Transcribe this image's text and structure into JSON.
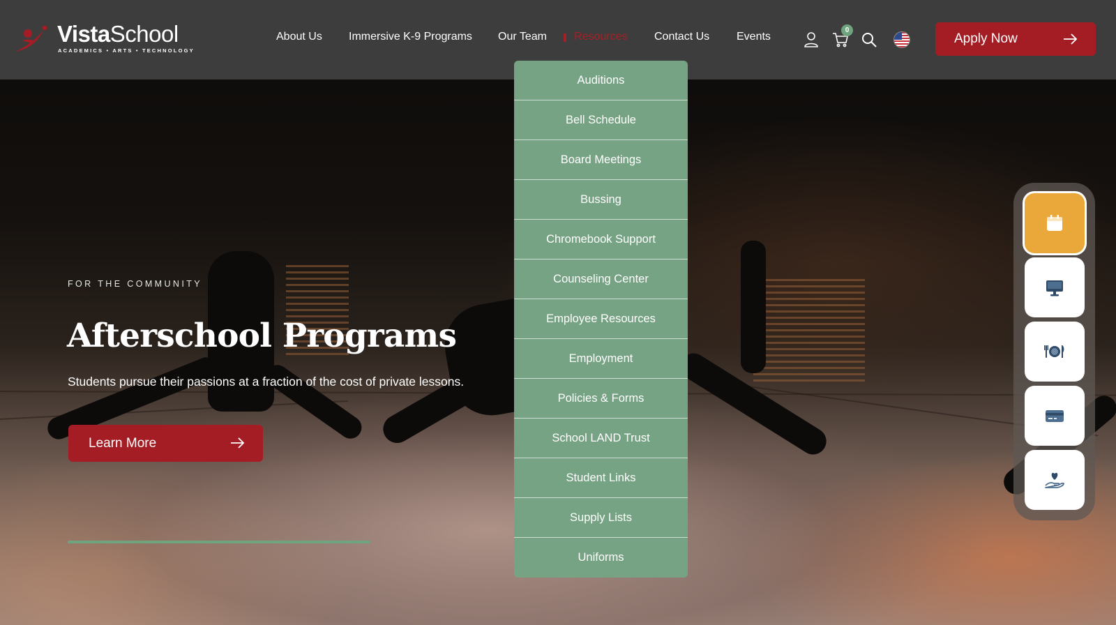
{
  "brand": {
    "name_bold": "Vista",
    "name_light": "School",
    "tagline": "ACADEMICS • ARTS • TECHNOLOGY",
    "accent_red": "#a51d24",
    "accent_green": "#76a383",
    "accent_orange": "#eaa73a"
  },
  "nav": {
    "items": [
      {
        "label": "About Us"
      },
      {
        "label": "Immersive K-9 Programs"
      },
      {
        "label": "Our Team"
      },
      {
        "label": "Resources",
        "active": true
      },
      {
        "label": "Contact Us"
      },
      {
        "label": "Events"
      }
    ],
    "cart_count": "0",
    "icons": [
      "user-icon",
      "cart-icon",
      "search-icon",
      "us-flag-icon"
    ],
    "apply_label": "Apply Now"
  },
  "dropdown": {
    "items": [
      "Auditions",
      "Bell Schedule",
      "Board Meetings",
      "Bussing",
      "Chromebook Support",
      "Counseling Center",
      "Employee Resources",
      "Employment",
      "Policies & Forms",
      "School LAND Trust",
      "Student Links",
      "Supply Lists",
      "Uniforms"
    ]
  },
  "hero": {
    "eyebrow": "FOR THE COMMUNITY",
    "title": "Afterschool Programs",
    "subtitle": "Students pursue their passions at a fraction of the cost of private lessons.",
    "cta_label": "Learn More",
    "slide_progress_fraction": 1.0
  },
  "quickbar": {
    "buttons": [
      {
        "icon": "calendar-icon",
        "active": true
      },
      {
        "icon": "monitor-icon",
        "active": false
      },
      {
        "icon": "dining-icon",
        "active": false
      },
      {
        "icon": "payment-card-icon",
        "active": false
      },
      {
        "icon": "donate-heart-hand-icon",
        "active": false
      }
    ]
  }
}
